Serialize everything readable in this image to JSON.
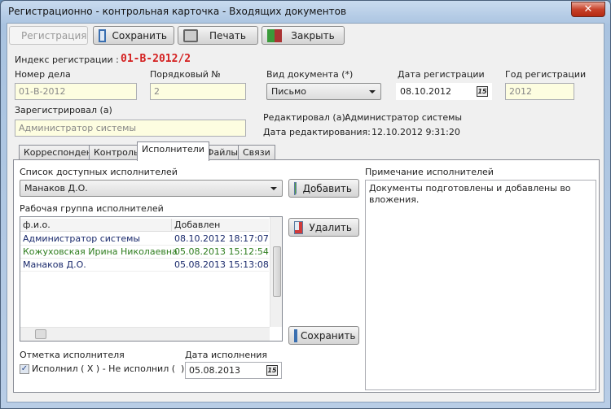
{
  "window": {
    "title": "Регистрационно - контрольная карточка - Входящих документов",
    "close": "✕"
  },
  "toolbar": {
    "register": "Регистрация",
    "save": "Сохранить",
    "print": "Печать",
    "close": "Закрыть"
  },
  "form": {
    "index_label": "Индекс регистрации :",
    "index_value": "01-В-2012/2",
    "case_label": "Номер дела",
    "case_value": "01-В-2012",
    "seq_label": "Порядковый №",
    "seq_value": "2",
    "doctype_label": "Вид документа (*)",
    "doctype_value": "Письмо",
    "regdate_label": "Дата регистрации",
    "regdate_value": "08.10.2012",
    "regyear_label": "Год регистрации",
    "regyear_value": "2012",
    "registered_label": "Зарегистрировал (а)",
    "registered_value": "Администратор системы",
    "edited_label": "Редактировал (а):",
    "edited_value": "Администратор системы",
    "editdate_label": "Дата редактирования:",
    "editdate_value": "12.10.2012 9:31:20",
    "cal_icon_text": "15"
  },
  "tabs": [
    "Корреспондент",
    "Контроль",
    "Исполнители",
    "Файлы",
    "Связи"
  ],
  "executors": {
    "available_label": "Список доступных исполнителей",
    "available_value": "Манаков Д.О.",
    "add": "Добавить",
    "remove": "Удалить",
    "save": "Сохранить",
    "group_label": "Рабочая группа исполнителей",
    "columns": [
      "ф.и.о.",
      "Добавлен"
    ],
    "rows": [
      {
        "name": "Администратор системы",
        "added": "08.10.2012 18:17:07",
        "color": "#1a2a6c"
      },
      {
        "name": "Кожуховская Ирина Николаевна",
        "added": "05.08.2013 15:12:54",
        "color": "#2e7d1e"
      },
      {
        "name": "Манаков Д.О.",
        "added": "05.08.2013 15:13:08",
        "color": "#1a2a6c"
      }
    ],
    "mark_label": "Отметка исполнителя",
    "mark_text": "Исполнил ( X ) - Не исполнил (  )",
    "mark_checked": true,
    "execdate_label": "Дата исполнения",
    "execdate_value": "05.08.2013",
    "note_label": "Примечание исполнителей",
    "note_value": "Документы подготовлены и добавлены во вложения."
  }
}
